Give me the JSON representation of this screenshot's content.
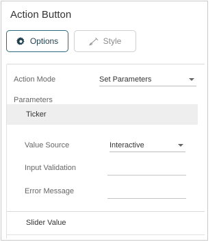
{
  "panel": {
    "title": "Action Button"
  },
  "tabs": {
    "options_label": "Options",
    "style_label": "Style",
    "options_icon": "gear-icon",
    "style_icon": "brush-icon",
    "accent_color": "#2b6a78"
  },
  "action_mode": {
    "label": "Action Mode",
    "value": "Set Parameters"
  },
  "parameters": {
    "section_label": "Parameters",
    "items": [
      {
        "label": "Ticker"
      },
      {
        "label": "Slider Value"
      }
    ],
    "value_source": {
      "label": "Value Source",
      "value": "Interactive"
    },
    "input_validation": {
      "label": "Input Validation",
      "value": ""
    },
    "error_message": {
      "label": "Error Message",
      "value": ""
    }
  }
}
